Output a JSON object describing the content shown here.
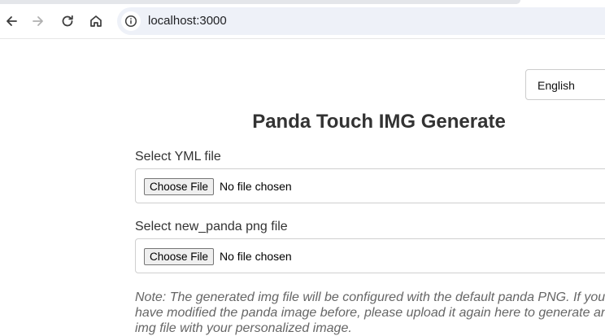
{
  "browser": {
    "url": "localhost:3000",
    "icons": [
      "back-icon",
      "forward-icon",
      "reload-icon",
      "home-icon",
      "site-info-icon"
    ]
  },
  "language_selector": {
    "selected": "English"
  },
  "title": "Panda Touch IMG Generate",
  "yml_field": {
    "label": "Select YML file",
    "button": "Choose File",
    "status": "No file chosen"
  },
  "png_field": {
    "label": "Select new_panda png file",
    "button": "Choose File",
    "status": "No file chosen"
  },
  "note": "Note: The generated img file will be configured with the default panda PNG. If you have modified the panda image before, please upload it again here to generate an img file with your personalized image."
}
